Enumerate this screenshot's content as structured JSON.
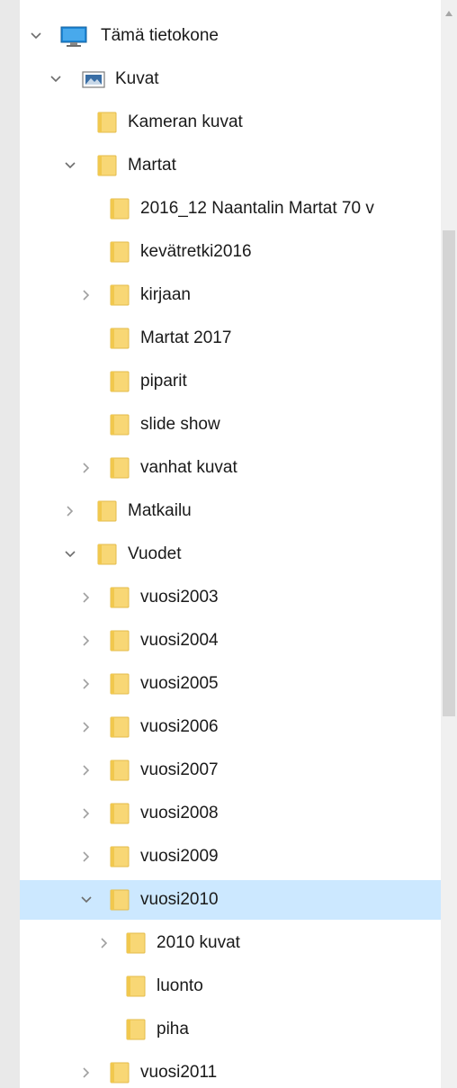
{
  "tree": {
    "this_pc": {
      "label": "Tämä tietokone",
      "icon": "computer-icon"
    },
    "pictures": {
      "label": "Kuvat",
      "icon": "pictures-folder-icon"
    },
    "items": [
      {
        "label": "Kameran kuvat"
      },
      {
        "label": "Martat"
      },
      {
        "label": "2016_12 Naantalin Martat 70 v"
      },
      {
        "label": "kevätretki2016"
      },
      {
        "label": "kirjaan"
      },
      {
        "label": "Martat 2017"
      },
      {
        "label": "piparit"
      },
      {
        "label": "slide show"
      },
      {
        "label": "vanhat kuvat"
      },
      {
        "label": "Matkailu"
      },
      {
        "label": "Vuodet"
      },
      {
        "label": "vuosi2003"
      },
      {
        "label": "vuosi2004"
      },
      {
        "label": "vuosi2005"
      },
      {
        "label": "vuosi2006"
      },
      {
        "label": "vuosi2007"
      },
      {
        "label": "vuosi2008"
      },
      {
        "label": "vuosi2009"
      },
      {
        "label": "vuosi2010"
      },
      {
        "label": "2010 kuvat"
      },
      {
        "label": "luonto"
      },
      {
        "label": "piha"
      },
      {
        "label": "vuosi2011"
      }
    ]
  },
  "icons": {
    "folder": "folder-icon",
    "expand": "chevron-right-icon",
    "collapse": "chevron-down-icon"
  },
  "colors": {
    "selection": "#cce8ff",
    "folder": "#f8d775"
  }
}
